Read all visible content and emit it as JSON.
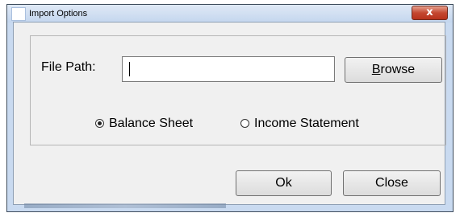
{
  "window": {
    "title": "Import Options",
    "close_glyph": "x"
  },
  "form": {
    "file_path_label": "File Path:",
    "file_path_value": "",
    "browse_accel": "B",
    "browse_rest": "rowse"
  },
  "options": [
    {
      "label": "Balance Sheet",
      "selected": true
    },
    {
      "label": "Income Statement",
      "selected": false
    }
  ],
  "buttons": {
    "ok": "Ok",
    "close": "Close"
  },
  "colors": {
    "titlebar": "#c9daf0",
    "close_button": "#c44730",
    "client_background": "#f0f0f0"
  }
}
